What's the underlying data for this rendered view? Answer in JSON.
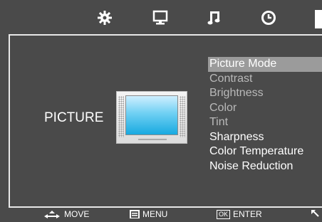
{
  "tabs": [
    {
      "icon": "gear-icon"
    },
    {
      "icon": "monitor-icon"
    },
    {
      "icon": "music-note-icon"
    },
    {
      "icon": "clock-icon"
    },
    {
      "icon": "active-tab-indicator"
    }
  ],
  "section": {
    "label": "PICTURE"
  },
  "menu": {
    "items": [
      {
        "label": "Picture  Mode",
        "state": "selected"
      },
      {
        "label": "Contrast",
        "state": "disabled"
      },
      {
        "label": "Brightness",
        "state": "disabled"
      },
      {
        "label": "Color",
        "state": "disabled"
      },
      {
        "label": "Tint",
        "state": "disabled"
      },
      {
        "label": "Sharpness",
        "state": "enabled"
      },
      {
        "label": "Color  Temperature",
        "state": "enabled"
      },
      {
        "label": "Noise  Reduction",
        "state": "enabled"
      }
    ]
  },
  "hints": {
    "move": "MOVE",
    "menu": "MENU",
    "ok_key": "OK",
    "enter": "ENTER"
  },
  "colors": {
    "background": "#4a4a4a",
    "border": "#e8e8e8",
    "selected_row": "#9b9b9b",
    "disabled_text": "#b9b9b9",
    "screen_blue": "#18a9e0"
  }
}
